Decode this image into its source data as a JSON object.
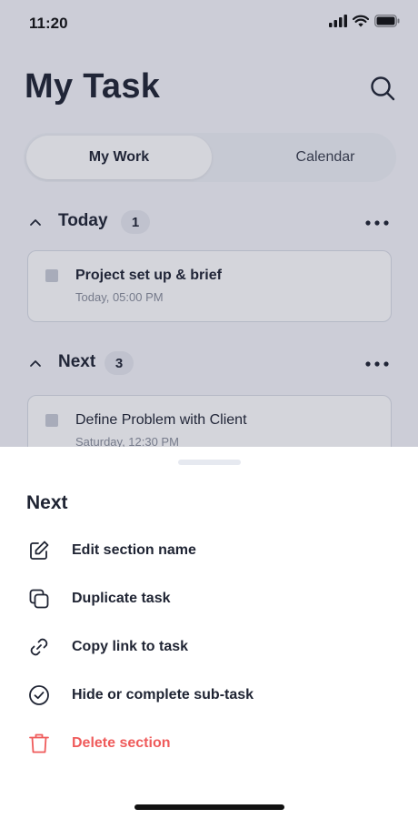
{
  "status_bar": {
    "time": "11:20"
  },
  "header": {
    "title": "My Task"
  },
  "tabs": [
    {
      "label": "My Work",
      "active": true
    },
    {
      "label": "Calendar",
      "active": false
    }
  ],
  "sections": [
    {
      "title": "Today",
      "count": "1",
      "tasks": [
        {
          "title": "Project set up & brief",
          "subtitle": "Today, 05:00 PM"
        }
      ]
    },
    {
      "title": "Next",
      "count": "3",
      "tasks": [
        {
          "title": "Define Problem with Client",
          "subtitle": "Saturday, 12:30 PM"
        }
      ]
    }
  ],
  "sheet": {
    "title": "Next",
    "items": [
      {
        "label": "Edit section name",
        "icon": "edit-icon"
      },
      {
        "label": "Duplicate task",
        "icon": "duplicate-icon"
      },
      {
        "label": "Copy link to task",
        "icon": "link-icon"
      },
      {
        "label": "Hide or complete sub-task",
        "icon": "check-circle-icon"
      },
      {
        "label": "Delete section",
        "icon": "trash-icon"
      }
    ]
  },
  "colors": {
    "text": "#1f2433",
    "danger": "#ef5b5b",
    "overlay": "#262c4c",
    "muted": "#8a8f9c"
  }
}
